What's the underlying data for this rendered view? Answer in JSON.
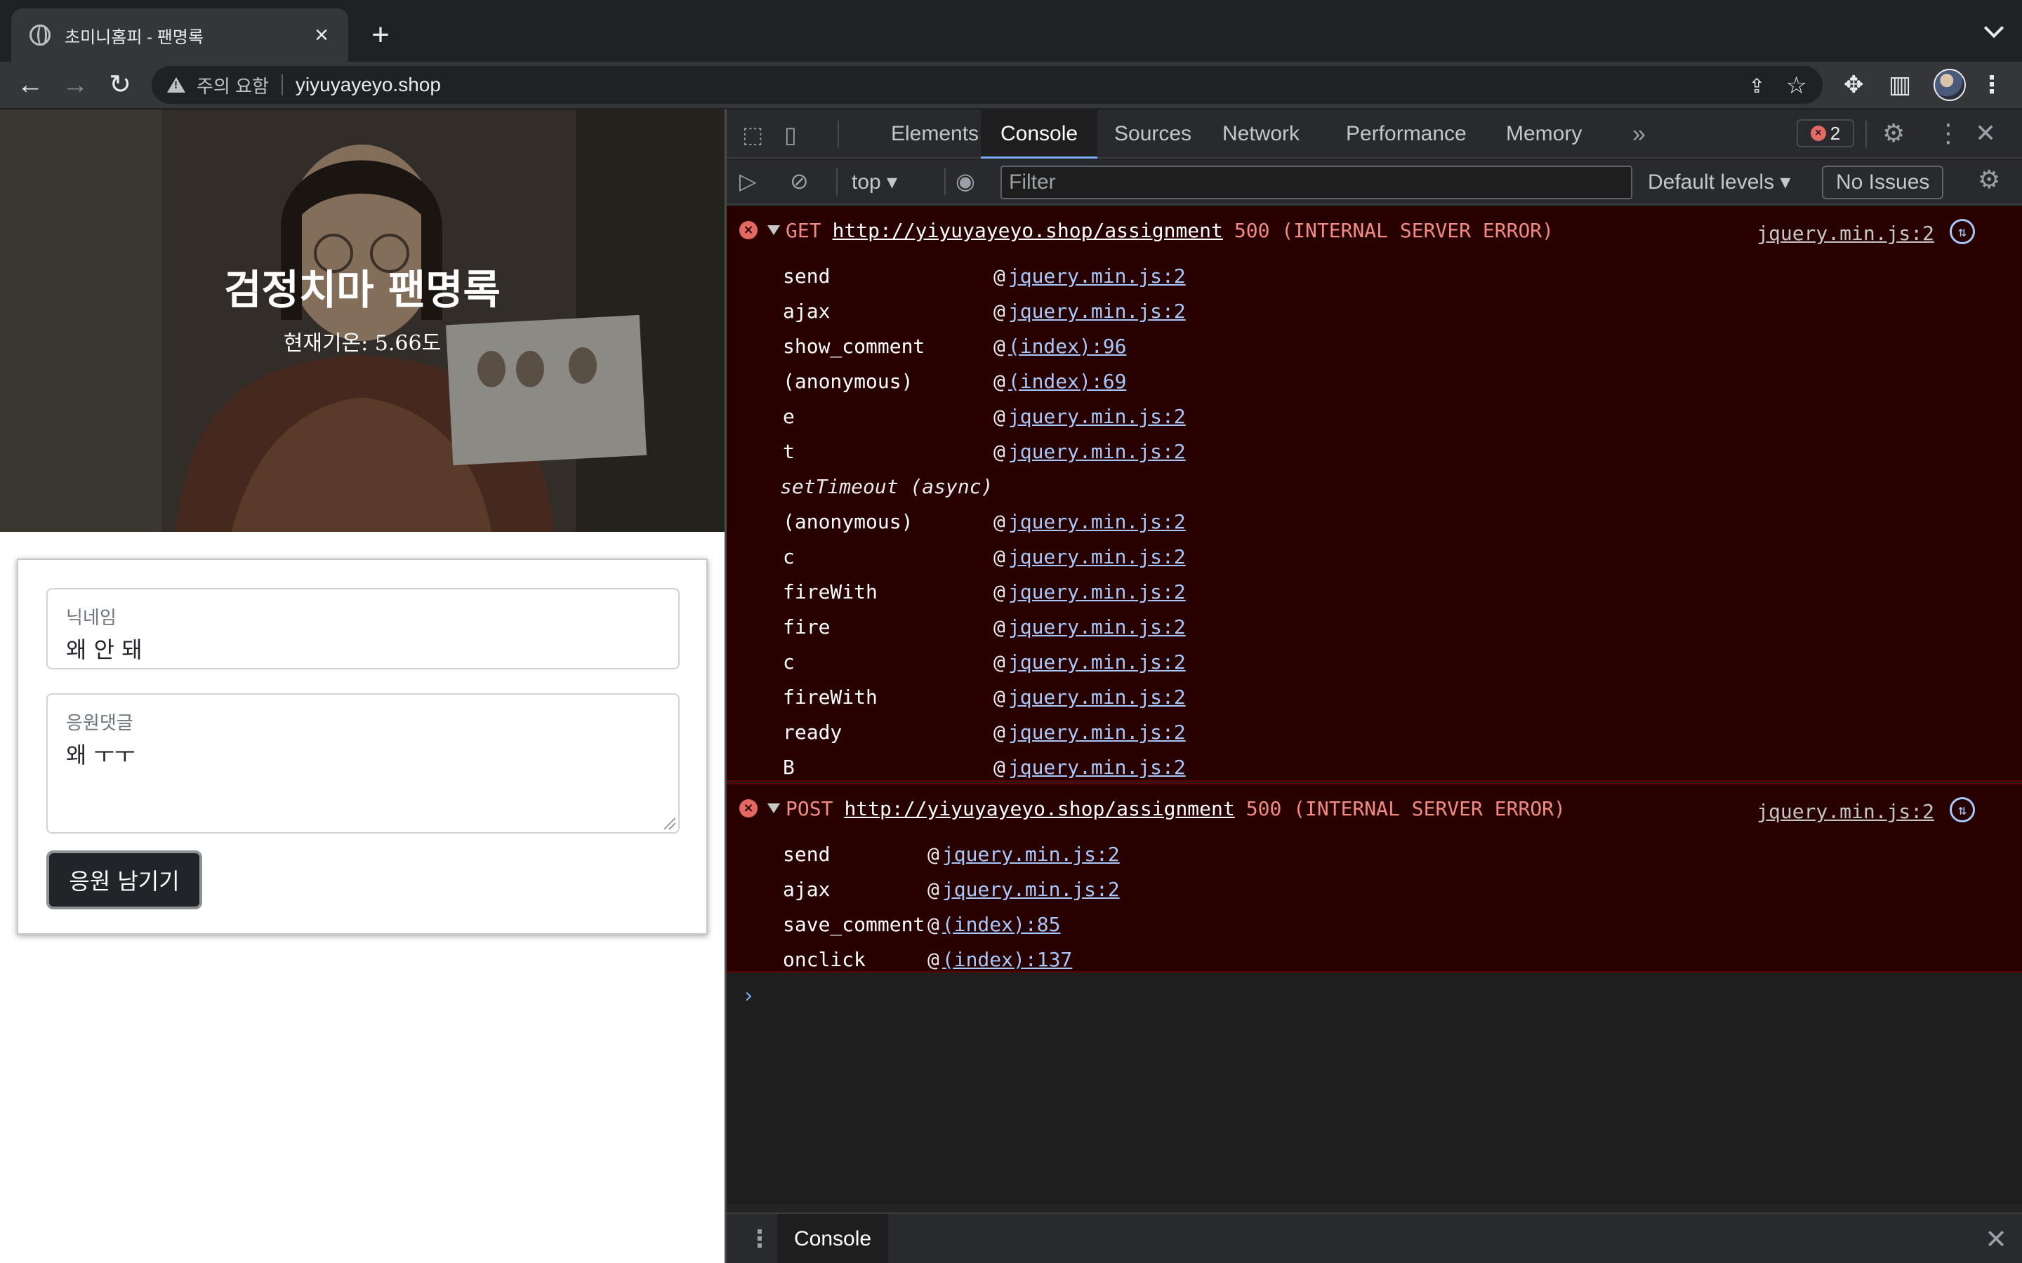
{
  "browser": {
    "tab_title": "초미니홈피 - 팬명록",
    "security_label": "주의 요함",
    "url": "yiyuyayeyo.shop"
  },
  "page": {
    "hero_title": "검정치마 팬명록",
    "temperature": "현재기온: 5.66도",
    "nickname_label": "닉네임",
    "nickname_value": "왜 안 돼",
    "comment_label": "응원댓글",
    "comment_value": "왜 ㅜㅜ",
    "submit_label": "응원 남기기"
  },
  "devtools": {
    "tabs": [
      "Elements",
      "Console",
      "Sources",
      "Network",
      "Performance",
      "Memory"
    ],
    "active_tab": "Console",
    "error_count": "2",
    "context": "top",
    "filter_placeholder": "Filter",
    "levels": "Default levels",
    "issues": "No Issues",
    "drawer_tab": "Console",
    "messages": [
      {
        "method": "GET",
        "url": "http://yiyuyayeyo.shop/assignment",
        "status": "500 (INTERNAL SERVER ERROR)",
        "source": "jquery.min.js:2",
        "frames": [
          {
            "fn": "send",
            "link": "jquery.min.js:2"
          },
          {
            "fn": "ajax",
            "link": "jquery.min.js:2"
          },
          {
            "fn": "show_comment",
            "link": "(index):96"
          },
          {
            "fn": "(anonymous)",
            "link": "(index):69"
          },
          {
            "fn": "e",
            "link": "jquery.min.js:2"
          },
          {
            "fn": "t",
            "link": "jquery.min.js:2"
          },
          {
            "async": "setTimeout (async)"
          },
          {
            "fn": "(anonymous)",
            "link": "jquery.min.js:2"
          },
          {
            "fn": "c",
            "link": "jquery.min.js:2"
          },
          {
            "fn": "fireWith",
            "link": "jquery.min.js:2"
          },
          {
            "fn": "fire",
            "link": "jquery.min.js:2"
          },
          {
            "fn": "c",
            "link": "jquery.min.js:2"
          },
          {
            "fn": "fireWith",
            "link": "jquery.min.js:2"
          },
          {
            "fn": "ready",
            "link": "jquery.min.js:2"
          },
          {
            "fn": "B",
            "link": "jquery.min.js:2"
          }
        ]
      },
      {
        "method": "POST",
        "url": "http://yiyuyayeyo.shop/assignment",
        "status": "500 (INTERNAL SERVER ERROR)",
        "source": "jquery.min.js:2",
        "frames": [
          {
            "fn": "send",
            "link": "jquery.min.js:2"
          },
          {
            "fn": "ajax",
            "link": "jquery.min.js:2"
          },
          {
            "fn": "save_comment",
            "link": "(index):85"
          },
          {
            "fn": "onclick",
            "link": "(index):137"
          }
        ]
      }
    ]
  },
  "icons": {
    "favicon": "globe-icon",
    "warning": "warning-triangle-icon",
    "extensions": "puzzle-icon"
  }
}
